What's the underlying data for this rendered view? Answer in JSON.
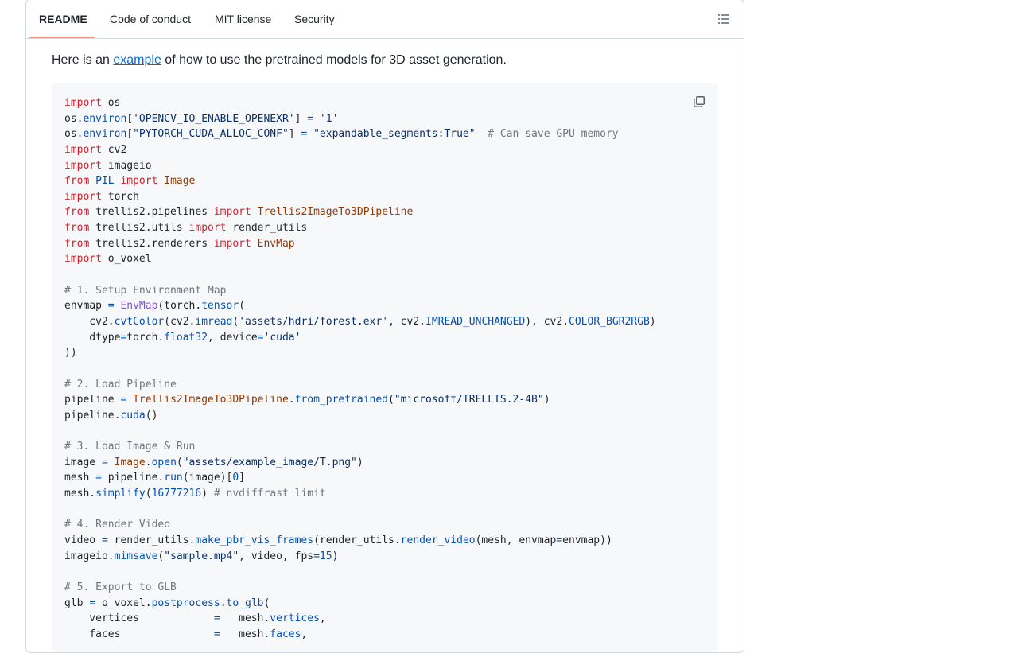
{
  "tabs": [
    {
      "label": "README",
      "active": true
    },
    {
      "label": "Code of conduct",
      "active": false
    },
    {
      "label": "MIT license",
      "active": false
    },
    {
      "label": "Security",
      "active": false
    }
  ],
  "intro": {
    "before": "Here is an ",
    "link": "example",
    "after": " of how to use the pretrained models for 3D asset generation."
  },
  "icons": {
    "outline": "list-unordered-icon",
    "copy": "copy-icon"
  },
  "colors": {
    "keyword": "#cf222e",
    "class": "#953800",
    "function": "#8250df",
    "string": "#0a3069",
    "constant": "#0550ae",
    "comment": "#6e7781",
    "tab_underline": "#fd8c73",
    "link": "#0969da"
  },
  "code_lines": [
    [
      [
        "kw",
        "import"
      ],
      [
        "pl",
        " os"
      ]
    ],
    [
      [
        "pl",
        "os."
      ],
      [
        "cst",
        "environ"
      ],
      [
        "pl",
        "["
      ],
      [
        "str",
        "'OPENCV_IO_ENABLE_OPENEXR'"
      ],
      [
        "pl",
        "] "
      ],
      [
        "cst",
        "="
      ],
      [
        "pl",
        " "
      ],
      [
        "str",
        "'1'"
      ]
    ],
    [
      [
        "pl",
        "os."
      ],
      [
        "cst",
        "environ"
      ],
      [
        "pl",
        "["
      ],
      [
        "str",
        "\"PYTORCH_CUDA_ALLOC_CONF\""
      ],
      [
        "pl",
        "] "
      ],
      [
        "cst",
        "="
      ],
      [
        "pl",
        " "
      ],
      [
        "str",
        "\"expandable_segments:True\""
      ],
      [
        "pl",
        "  "
      ],
      [
        "cm",
        "# Can save GPU memory"
      ]
    ],
    [
      [
        "kw",
        "import"
      ],
      [
        "pl",
        " cv2"
      ]
    ],
    [
      [
        "kw",
        "import"
      ],
      [
        "pl",
        " imageio"
      ]
    ],
    [
      [
        "kw",
        "from"
      ],
      [
        "pl",
        " "
      ],
      [
        "cst",
        "PIL"
      ],
      [
        "pl",
        " "
      ],
      [
        "kw",
        "import"
      ],
      [
        "pl",
        " "
      ],
      [
        "cls",
        "Image"
      ]
    ],
    [
      [
        "kw",
        "import"
      ],
      [
        "pl",
        " torch"
      ]
    ],
    [
      [
        "kw",
        "from"
      ],
      [
        "pl",
        " trellis2.pipelines "
      ],
      [
        "kw",
        "import"
      ],
      [
        "pl",
        " "
      ],
      [
        "cls",
        "Trellis2ImageTo3DPipeline"
      ]
    ],
    [
      [
        "kw",
        "from"
      ],
      [
        "pl",
        " trellis2.utils "
      ],
      [
        "kw",
        "import"
      ],
      [
        "pl",
        " render_utils"
      ]
    ],
    [
      [
        "kw",
        "from"
      ],
      [
        "pl",
        " trellis2.renderers "
      ],
      [
        "kw",
        "import"
      ],
      [
        "pl",
        " "
      ],
      [
        "cls",
        "EnvMap"
      ]
    ],
    [
      [
        "kw",
        "import"
      ],
      [
        "pl",
        " o_voxel"
      ]
    ],
    [],
    [
      [
        "cm",
        "# 1. Setup Environment Map"
      ]
    ],
    [
      [
        "pl",
        "envmap "
      ],
      [
        "cst",
        "="
      ],
      [
        "pl",
        " "
      ],
      [
        "fn",
        "EnvMap"
      ],
      [
        "pl",
        "(torch."
      ],
      [
        "cst",
        "tensor"
      ],
      [
        "pl",
        "("
      ]
    ],
    [
      [
        "pl",
        "    cv2."
      ],
      [
        "cst",
        "cvtColor"
      ],
      [
        "pl",
        "(cv2."
      ],
      [
        "cst",
        "imread"
      ],
      [
        "pl",
        "("
      ],
      [
        "str",
        "'assets/hdri/forest.exr'"
      ],
      [
        "pl",
        ", cv2."
      ],
      [
        "cst",
        "IMREAD_UNCHANGED"
      ],
      [
        "pl",
        "), cv2."
      ],
      [
        "cst",
        "COLOR_BGR2RGB"
      ],
      [
        "pl",
        ")"
      ]
    ],
    [
      [
        "pl",
        "    dtype"
      ],
      [
        "cst",
        "="
      ],
      [
        "pl",
        "torch."
      ],
      [
        "cst",
        "float32"
      ],
      [
        "pl",
        ", device"
      ],
      [
        "cst",
        "="
      ],
      [
        "str",
        "'cuda'"
      ]
    ],
    [
      [
        "pl",
        "))"
      ]
    ],
    [],
    [
      [
        "cm",
        "# 2. Load Pipeline"
      ]
    ],
    [
      [
        "pl",
        "pipeline "
      ],
      [
        "cst",
        "="
      ],
      [
        "pl",
        " "
      ],
      [
        "cls",
        "Trellis2ImageTo3DPipeline"
      ],
      [
        "pl",
        "."
      ],
      [
        "cst",
        "from_pretrained"
      ],
      [
        "pl",
        "("
      ],
      [
        "str",
        "\"microsoft/TRELLIS.2-4B\""
      ],
      [
        "pl",
        ")"
      ]
    ],
    [
      [
        "pl",
        "pipeline."
      ],
      [
        "cst",
        "cuda"
      ],
      [
        "pl",
        "()"
      ]
    ],
    [],
    [
      [
        "cm",
        "# 3. Load Image & Run"
      ]
    ],
    [
      [
        "pl",
        "image "
      ],
      [
        "cst",
        "="
      ],
      [
        "pl",
        " "
      ],
      [
        "cls",
        "Image"
      ],
      [
        "pl",
        "."
      ],
      [
        "cst",
        "open"
      ],
      [
        "pl",
        "("
      ],
      [
        "str",
        "\"assets/example_image/T.png\""
      ],
      [
        "pl",
        ")"
      ]
    ],
    [
      [
        "pl",
        "mesh "
      ],
      [
        "cst",
        "="
      ],
      [
        "pl",
        " pipeline."
      ],
      [
        "cst",
        "run"
      ],
      [
        "pl",
        "(image)["
      ],
      [
        "cst",
        "0"
      ],
      [
        "pl",
        "]"
      ]
    ],
    [
      [
        "pl",
        "mesh."
      ],
      [
        "cst",
        "simplify"
      ],
      [
        "pl",
        "("
      ],
      [
        "cst",
        "16777216"
      ],
      [
        "pl",
        ") "
      ],
      [
        "cm",
        "# nvdiffrast limit"
      ]
    ],
    [],
    [
      [
        "cm",
        "# 4. Render Video"
      ]
    ],
    [
      [
        "pl",
        "video "
      ],
      [
        "cst",
        "="
      ],
      [
        "pl",
        " render_utils."
      ],
      [
        "cst",
        "make_pbr_vis_frames"
      ],
      [
        "pl",
        "(render_utils."
      ],
      [
        "cst",
        "render_video"
      ],
      [
        "pl",
        "(mesh, envmap"
      ],
      [
        "cst",
        "="
      ],
      [
        "pl",
        "envmap))"
      ]
    ],
    [
      [
        "pl",
        "imageio."
      ],
      [
        "cst",
        "mimsave"
      ],
      [
        "pl",
        "("
      ],
      [
        "str",
        "\"sample.mp4\""
      ],
      [
        "pl",
        ", video, fps"
      ],
      [
        "cst",
        "="
      ],
      [
        "cst",
        "15"
      ],
      [
        "pl",
        ")"
      ]
    ],
    [],
    [
      [
        "cm",
        "# 5. Export to GLB"
      ]
    ],
    [
      [
        "pl",
        "glb "
      ],
      [
        "cst",
        "="
      ],
      [
        "pl",
        " o_voxel."
      ],
      [
        "cst",
        "postprocess"
      ],
      [
        "pl",
        "."
      ],
      [
        "cst",
        "to_glb"
      ],
      [
        "pl",
        "("
      ]
    ],
    [
      [
        "pl",
        "    vertices            "
      ],
      [
        "cst",
        "="
      ],
      [
        "pl",
        "   mesh."
      ],
      [
        "cst",
        "vertices"
      ],
      [
        "pl",
        ","
      ]
    ],
    [
      [
        "pl",
        "    faces               "
      ],
      [
        "cst",
        "="
      ],
      [
        "pl",
        "   mesh."
      ],
      [
        "cst",
        "faces"
      ],
      [
        "pl",
        ","
      ]
    ]
  ]
}
